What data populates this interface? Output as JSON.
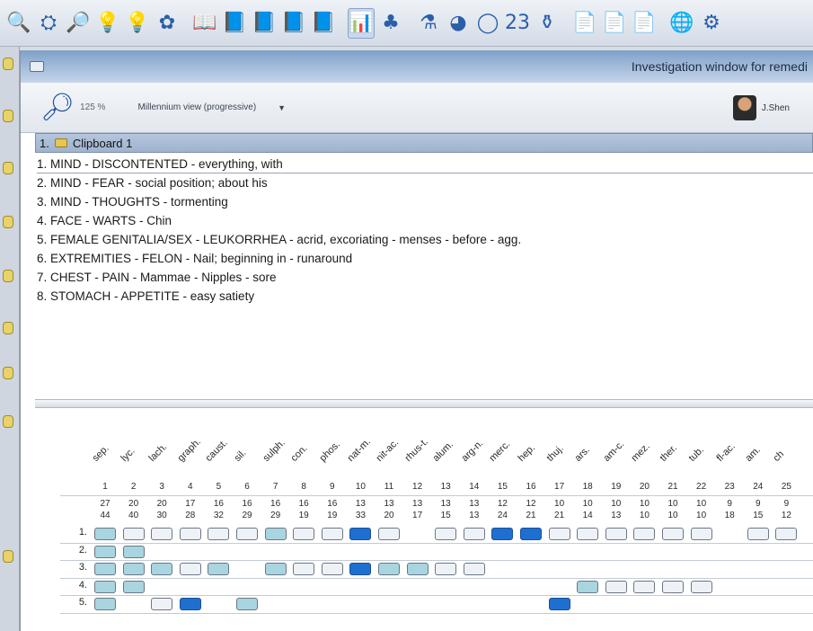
{
  "toolbar": {
    "icons": [
      "binoculars-icon",
      "glasses-icon",
      "search-icon",
      "bulb-icon",
      "bulb-question-icon",
      "leaf-icon",
      "book-open-icon",
      "book-icon",
      "book-icon",
      "book-icon",
      "book-icon",
      "analysis-icon",
      "figure-icon",
      "flask-icon",
      "cap-icon",
      "circle-icon",
      "number-icon",
      "vial-icon",
      "page-icon",
      "page-icon",
      "page-icon",
      "globe-icon",
      "gear-icon"
    ],
    "glyphs": [
      "🔍",
      "⛭",
      "🔎",
      "💡",
      "💡",
      "✿",
      "📖",
      "📘",
      "📘",
      "📘",
      "📘",
      "📊",
      "♣",
      "⚗",
      "◕",
      "◯",
      "23",
      "⚱",
      "📄",
      "📄",
      "📄",
      "🌐",
      "⚙"
    ],
    "active_index": 11
  },
  "window": {
    "title": "Investigation window for remedi"
  },
  "options": {
    "zoom": "125 %",
    "view": "Millennium view (progressive)",
    "user": "J.Shen"
  },
  "clipboard": {
    "label": "1.",
    "name": "Clipboard 1",
    "rubrics": [
      "1. MIND - DISCONTENTED - everything, with",
      "2. MIND - FEAR - social position; about his",
      "3. MIND - THOUGHTS - tormenting",
      "4. FACE - WARTS - Chin",
      "5. FEMALE GENITALIA/SEX - LEUKORRHEA - acrid, excoriating - menses - before - agg.",
      "6. EXTREMITIES - FELON - Nail; beginning in - runaround",
      "7. CHEST - PAIN - Mammae - Nipples - sore",
      "8. STOMACH - APPETITE - easy satiety"
    ]
  },
  "grid": {
    "remedies": [
      "sep.",
      "lyc.",
      "lach.",
      "graph.",
      "caust.",
      "sil.",
      "sulph.",
      "con.",
      "phos.",
      "nat-m.",
      "nit-ac.",
      "rhus-t.",
      "alum.",
      "arg-n.",
      "merc.",
      "hep.",
      "thuj.",
      "ars.",
      "am-c.",
      "mez.",
      "ther.",
      "tub.",
      "fl-ac.",
      "am.",
      "ch"
    ],
    "numbers": [
      "1",
      "2",
      "3",
      "4",
      "5",
      "6",
      "7",
      "8",
      "9",
      "10",
      "11",
      "12",
      "13",
      "14",
      "15",
      "16",
      "17",
      "18",
      "19",
      "20",
      "21",
      "22",
      "23",
      "24",
      "25"
    ],
    "totals1": [
      "27",
      "20",
      "20",
      "17",
      "16",
      "16",
      "16",
      "16",
      "16",
      "13",
      "13",
      "13",
      "13",
      "13",
      "12",
      "12",
      "10",
      "10",
      "10",
      "10",
      "10",
      "10",
      "9",
      "9",
      "9"
    ],
    "totals2": [
      "44",
      "40",
      "30",
      "28",
      "32",
      "29",
      "29",
      "19",
      "19",
      "33",
      "20",
      "17",
      "15",
      "13",
      "24",
      "21",
      "21",
      "14",
      "13",
      "10",
      "10",
      "10",
      "18",
      "15",
      "12"
    ],
    "row_labels": [
      "1.",
      "2.",
      "3.",
      "4.",
      "5."
    ],
    "rows": [
      [
        2,
        1,
        1,
        1,
        1,
        1,
        2,
        1,
        1,
        3,
        1,
        0,
        1,
        1,
        3,
        3,
        1,
        1,
        1,
        1,
        1,
        1,
        0,
        1,
        1
      ],
      [
        2,
        2,
        0,
        0,
        0,
        0,
        0,
        0,
        0,
        0,
        0,
        0,
        0,
        0,
        0,
        0,
        0,
        0,
        0,
        0,
        0,
        0,
        0,
        0,
        0
      ],
      [
        2,
        2,
        2,
        1,
        2,
        0,
        2,
        1,
        1,
        3,
        2,
        2,
        1,
        1,
        0,
        0,
        0,
        0,
        0,
        0,
        0,
        0,
        0,
        0,
        0
      ],
      [
        2,
        2,
        0,
        0,
        0,
        0,
        0,
        0,
        0,
        0,
        0,
        0,
        0,
        0,
        0,
        0,
        0,
        2,
        1,
        1,
        1,
        1,
        0,
        0,
        0
      ],
      [
        2,
        0,
        1,
        3,
        0,
        2,
        0,
        0,
        0,
        0,
        0,
        0,
        0,
        0,
        0,
        0,
        3,
        0,
        0,
        0,
        0,
        0,
        0,
        0,
        0
      ]
    ]
  }
}
